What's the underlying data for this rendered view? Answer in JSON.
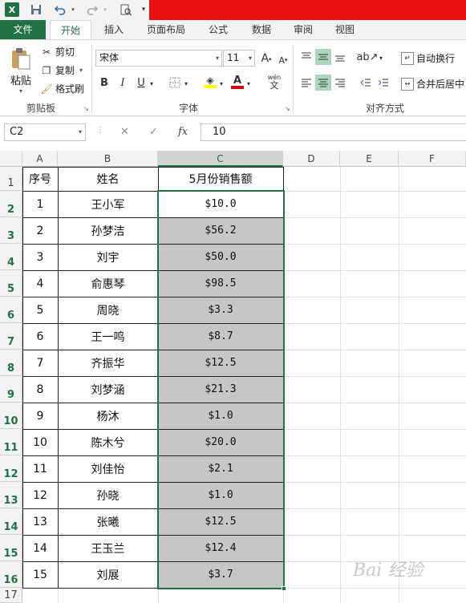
{
  "qat": {
    "app_logo": "X",
    "icons": [
      "excel-logo",
      "save-icon",
      "undo-icon",
      "redo-icon",
      "print-preview-icon"
    ]
  },
  "tabs": [
    "文件",
    "开始",
    "插入",
    "页面布局",
    "公式",
    "数据",
    "审阅",
    "视图"
  ],
  "ribbon": {
    "clipboard": {
      "paste": "粘贴",
      "cut": "剪切",
      "copy": "复制",
      "format_painter": "格式刷",
      "label": "剪贴板"
    },
    "font": {
      "name": "宋体",
      "size": "11",
      "bold": "B",
      "italic": "I",
      "underline": "U",
      "label": "字体",
      "grow": "A",
      "shrink": "A",
      "wen": "wén"
    },
    "alignment": {
      "wrap": "自动换行",
      "merge": "合并后居中",
      "label": "对齐方式"
    }
  },
  "formula_bar": {
    "name_box": "C2",
    "cancel": "✕",
    "enter": "✓",
    "fx": "fx",
    "value": "10"
  },
  "columns": [
    "A",
    "B",
    "C",
    "D",
    "E",
    "F"
  ],
  "row_numbers": [
    "1",
    "2",
    "3",
    "4",
    "5",
    "6",
    "7",
    "8",
    "9",
    "10",
    "11",
    "12",
    "13",
    "14",
    "15",
    "16",
    "17"
  ],
  "table": {
    "headers": [
      "序号",
      "姓名",
      "5月份销售额"
    ],
    "rows": [
      [
        "1",
        "王小军",
        "$10.0"
      ],
      [
        "2",
        "孙梦洁",
        "$56.2"
      ],
      [
        "3",
        "刘宇",
        "$50.0"
      ],
      [
        "4",
        "俞惠琴",
        "$98.5"
      ],
      [
        "5",
        "周晓",
        "$3.3"
      ],
      [
        "6",
        "王一鸣",
        "$8.7"
      ],
      [
        "7",
        "齐振华",
        "$12.5"
      ],
      [
        "8",
        "刘梦涵",
        "$21.3"
      ],
      [
        "9",
        "杨沐",
        "$1.0"
      ],
      [
        "10",
        "陈木兮",
        "$20.0"
      ],
      [
        "11",
        "刘佳怡",
        "$2.1"
      ],
      [
        "12",
        "孙晓",
        "$1.0"
      ],
      [
        "13",
        "张曦",
        "$12.5"
      ],
      [
        "14",
        "王玉兰",
        "$12.4"
      ],
      [
        "15",
        "刘展",
        "$3.7"
      ]
    ]
  },
  "colors": {
    "excel_green": "#217346",
    "title_red": "#e81010",
    "selection_fill": "#c6c6c6"
  },
  "watermark": "Bai 经验"
}
